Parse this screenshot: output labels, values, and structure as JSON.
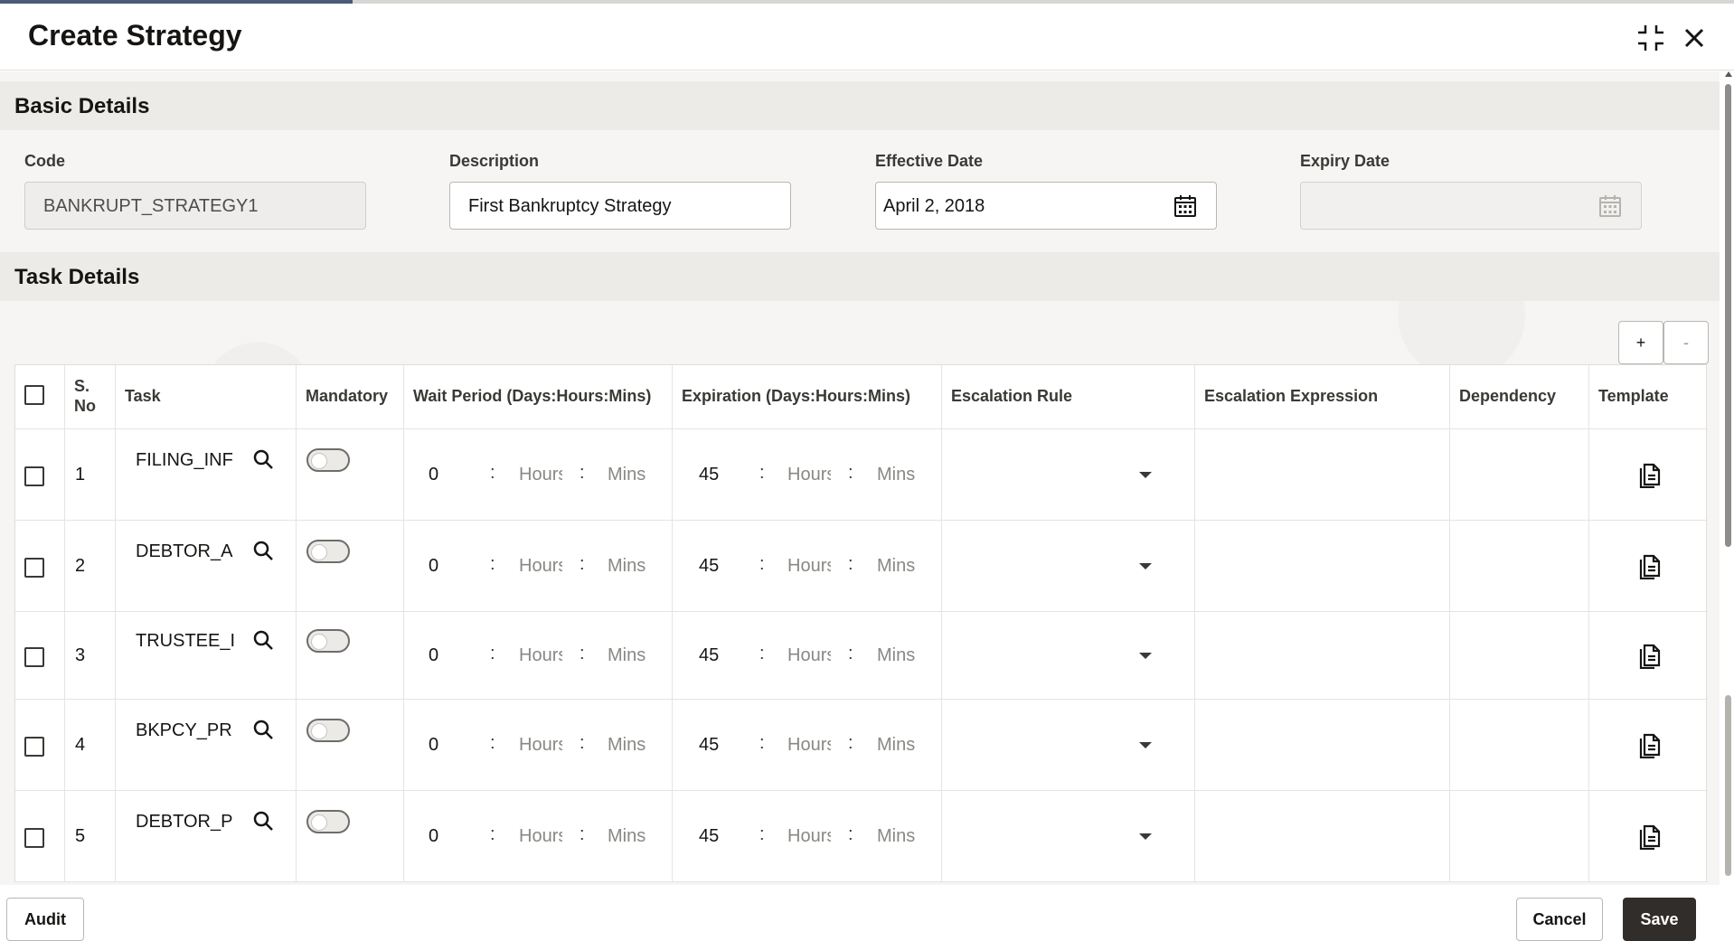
{
  "dialog": {
    "title": "Create Strategy"
  },
  "basic_details": {
    "section_title": "Basic Details",
    "code_label": "Code",
    "code_value": "BANKRUPT_STRATEGY1",
    "description_label": "Description",
    "description_value": "First Bankruptcy Strategy",
    "effective_date_label": "Effective Date",
    "effective_date_value": "April 2, 2018",
    "expiry_date_label": "Expiry Date",
    "expiry_date_value": ""
  },
  "task_details": {
    "section_title": "Task Details",
    "add_label": "+",
    "remove_label": "-",
    "columns": {
      "sno": "S. No",
      "task": "Task",
      "mandatory": "Mandatory",
      "wait_period": "Wait Period (Days:Hours:Mins)",
      "expiration": "Expiration (Days:Hours:Mins)",
      "escalation_rule": "Escalation Rule",
      "escalation_expression": "Escalation Expression",
      "dependency": "Dependency",
      "template": "Template"
    },
    "hours_placeholder": "Hours",
    "mins_placeholder": "Mins",
    "separator": ":",
    "rows": [
      {
        "sno": "1",
        "task": "FILING_INF",
        "mandatory": false,
        "wait_days": "0",
        "exp_days": "45"
      },
      {
        "sno": "2",
        "task": "DEBTOR_A",
        "mandatory": false,
        "wait_days": "0",
        "exp_days": "45"
      },
      {
        "sno": "3",
        "task": "TRUSTEE_I",
        "mandatory": false,
        "wait_days": "0",
        "exp_days": "45"
      },
      {
        "sno": "4",
        "task": "BKPCY_PR",
        "mandatory": false,
        "wait_days": "0",
        "exp_days": "45"
      },
      {
        "sno": "5",
        "task": "DEBTOR_P",
        "mandatory": false,
        "wait_days": "0",
        "exp_days": "45"
      }
    ]
  },
  "footer": {
    "audit_label": "Audit",
    "cancel_label": "Cancel",
    "save_label": "Save"
  },
  "icons": {
    "minimize": "collapse-icon",
    "close": "close-icon",
    "calendar": "calendar-icon",
    "search": "search-icon",
    "template": "document-icon",
    "dropdown": "caret-down-icon"
  },
  "colors": {
    "primary_button": "#312d2a",
    "section_bar": "#ecebe8"
  }
}
